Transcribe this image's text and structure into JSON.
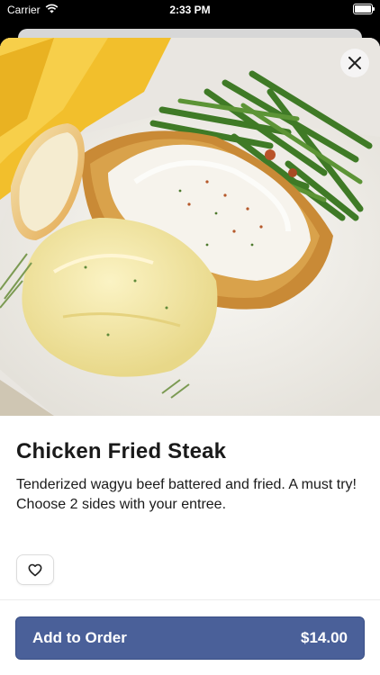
{
  "status_bar": {
    "carrier": "Carrier",
    "time": "2:33 PM",
    "battery_level": 1.0
  },
  "modal": {
    "close_icon": "close-icon",
    "item": {
      "name": "Chicken Fried Steak",
      "description_line1": "Tenderized wagyu beef battered and fried. A must try!",
      "description_line2": "Choose 2 sides with your entree."
    },
    "favorite_icon": "heart-outline-icon",
    "add_button": {
      "label": "Add to Order",
      "price": "$14.00"
    }
  },
  "colors": {
    "primary_button": "#4a6099",
    "text": "#1a1a1a"
  }
}
